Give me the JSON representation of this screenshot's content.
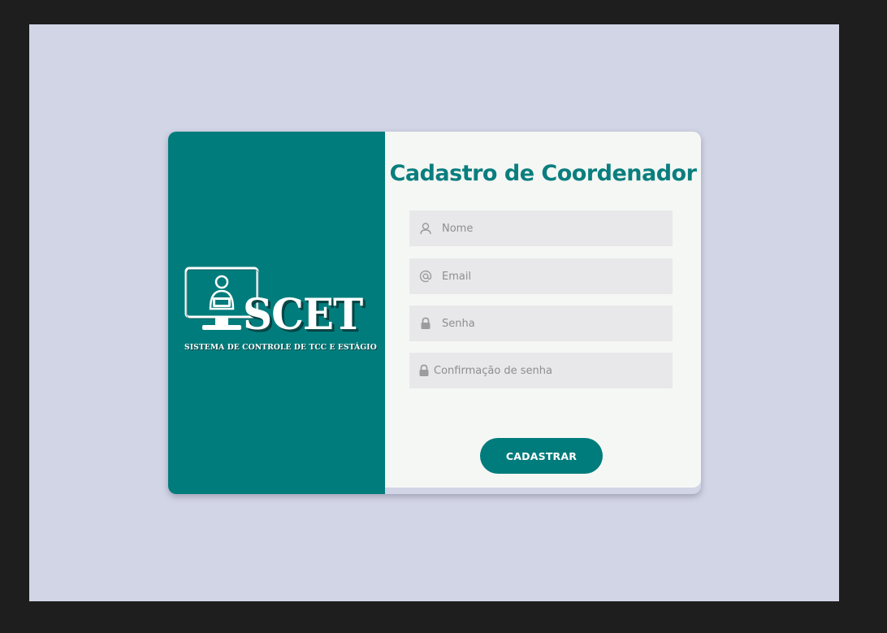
{
  "brand": {
    "logo_word": "SCET",
    "logo_subtitle": "SISTEMA DE CONTROLE DE TCC  E ESTÁGIO",
    "panel_color": "#007c7c"
  },
  "form": {
    "title": "Cadastro de Coordenador",
    "fields": [
      {
        "name": "nome",
        "placeholder": "Nome",
        "value": "",
        "icon": "user-icon"
      },
      {
        "name": "email",
        "placeholder": "Email",
        "value": "",
        "icon": "at-icon"
      },
      {
        "name": "senha",
        "placeholder": "Senha",
        "value": "",
        "icon": "lock-icon"
      },
      {
        "name": "confirmacao",
        "placeholder": "Confirmação de senha",
        "value": "",
        "icon": "lock-icon"
      }
    ],
    "submit_label": "CADASTRAR"
  },
  "colors": {
    "page_background": "#d2d5e6",
    "form_background": "#f5f7f4",
    "field_background": "#e8e8ea",
    "accent": "#0a7e7e"
  }
}
